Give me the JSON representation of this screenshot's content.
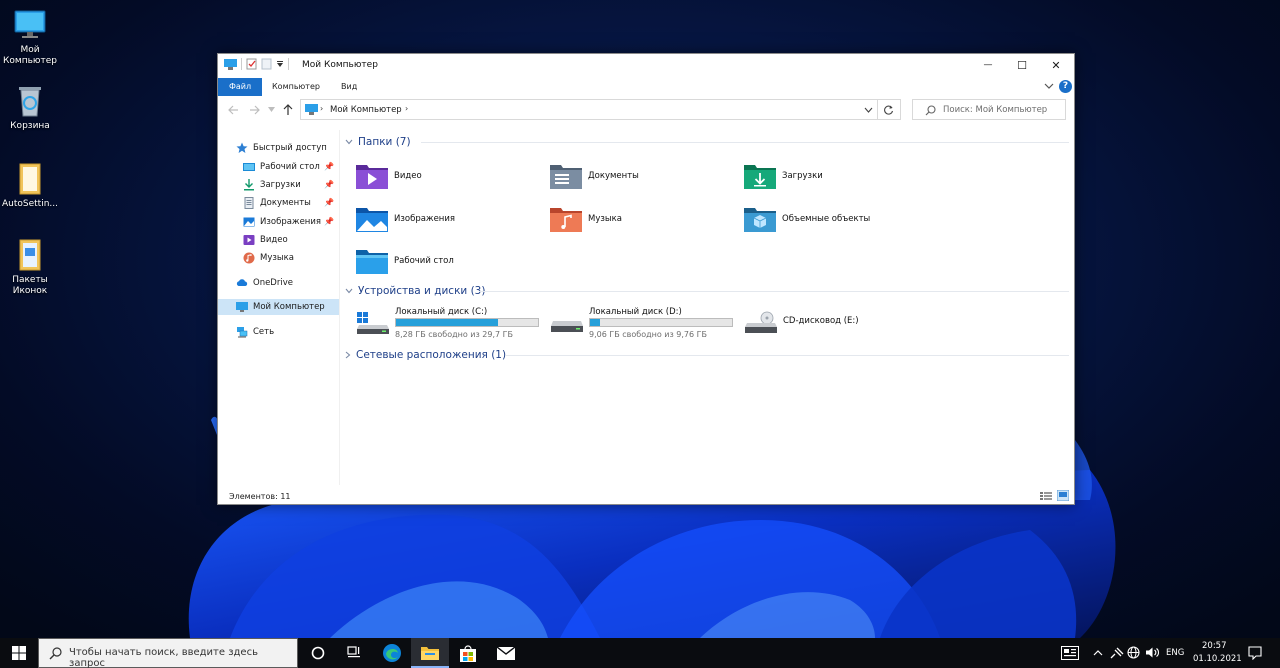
{
  "desktop": {
    "icons": [
      {
        "label": "Мой Компьютер",
        "icon": "monitor-icon"
      },
      {
        "label": "Корзина",
        "icon": "recycle-bin-icon"
      },
      {
        "label": "AutoSettin...",
        "icon": "folder-icon"
      },
      {
        "label": "Пакеты Иконок",
        "icon": "folder-icon"
      }
    ]
  },
  "window": {
    "title": "Мой Компьютер",
    "controls": {
      "minimize": "—",
      "maximize": "☐",
      "close": "✕"
    },
    "ribbon_tabs": [
      "Файл",
      "Компьютер",
      "Вид"
    ],
    "help": "?",
    "address": {
      "path": "Мой Компьютер"
    },
    "search_placeholder": "Поиск: Мой Компьютер",
    "sidebar": {
      "quick_access": "Быстрый доступ",
      "pinned": [
        {
          "label": "Рабочий стол",
          "icon": "desktop-icon"
        },
        {
          "label": "Загрузки",
          "icon": "download-icon"
        },
        {
          "label": "Документы",
          "icon": "document-icon"
        },
        {
          "label": "Изображения",
          "icon": "pictures-icon"
        }
      ],
      "unpinned": [
        {
          "label": "Видео",
          "icon": "video-icon"
        },
        {
          "label": "Музыка",
          "icon": "music-icon"
        }
      ],
      "onedrive": "OneDrive",
      "this_pc": "Мой Компьютер",
      "network": "Сеть"
    },
    "groups": {
      "folders": {
        "title": "Папки (7)"
      },
      "devices": {
        "title": "Устройства и диски (3)"
      },
      "network": {
        "title": "Сетевые расположения (1)"
      }
    },
    "folders": [
      {
        "label": "Видео",
        "color": "#7a3fc2"
      },
      {
        "label": "Документы",
        "color": "#6d7f93"
      },
      {
        "label": "Загрузки",
        "color": "#12996b"
      },
      {
        "label": "Изображения",
        "color": "#1a7ad8"
      },
      {
        "label": "Музыка",
        "color": "#e06a4a"
      },
      {
        "label": "Объемные объекты",
        "color": "#2d84b9"
      },
      {
        "label": "Рабочий стол",
        "color": "#1b8bd6"
      }
    ],
    "drives": [
      {
        "name": "Локальный диск (C:)",
        "free": "8,28 ГБ свободно из 29,7 ГБ",
        "used_fraction": 0.72
      },
      {
        "name": "Локальный диск (D:)",
        "free": "9,06 ГБ свободно из 9,76 ГБ",
        "used_fraction": 0.07
      },
      {
        "name": "CD-дисковод (E:)"
      }
    ],
    "status": "Элементов: 11"
  },
  "taskbar": {
    "search_placeholder": "Чтобы начать поиск, введите здесь запрос",
    "language": "ENG",
    "time": "20:57",
    "date": "01.10.2021"
  },
  "colors": {
    "accent": "#1a6fc9",
    "selection": "#cce4f7",
    "group_header": "#1e3f88",
    "drive_fill": "#26a0da"
  }
}
